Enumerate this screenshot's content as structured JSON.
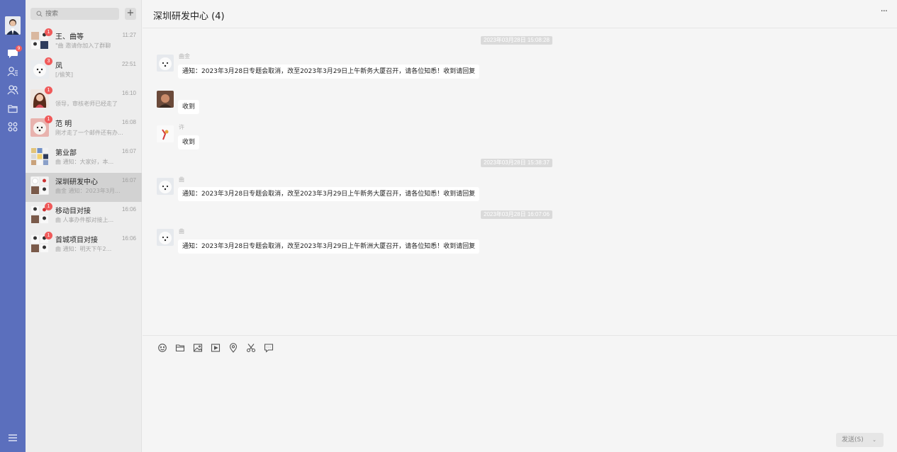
{
  "search": {
    "placeholder": "搜索"
  },
  "add_label": "+",
  "rail": {
    "unread_badge": "9"
  },
  "conversations": [
    {
      "name": "王、曲等",
      "time": "11:27",
      "preview": "\"曲 邀请你加入了群聊",
      "badge": "1"
    },
    {
      "name": "凤",
      "time": "22:51",
      "preview": "[/偷笑]",
      "badge": "3"
    },
    {
      "name": "",
      "time": "16:10",
      "preview": "领导，审核老师已经走了",
      "badge": "1"
    },
    {
      "name": "范 明",
      "time": "16:08",
      "preview": "刚才走了一个邮件还有办...",
      "badge": "1"
    },
    {
      "name": "第业部",
      "time": "16:07",
      "preview": "曲 通知：大家好，本...",
      "badge": ""
    },
    {
      "name": "深圳研发中心",
      "time": "16:07",
      "preview": "曲金 通知：2023年3月...",
      "badge": ""
    },
    {
      "name": "移动目对接",
      "time": "16:06",
      "preview": "曲 人事办件都对接上...",
      "badge": "1"
    },
    {
      "name": "首城项目对接",
      "time": "16:06",
      "preview": "曲 通知：明天下午2...",
      "badge": "1"
    }
  ],
  "chat": {
    "title": "深圳研发中心 (4)",
    "more": "···",
    "timestamps": [
      "2023年03月28日 15:08:28",
      "2023年03月28日 15:38:37",
      "2023年03月28日 16:07:06"
    ],
    "messages": [
      {
        "sender": "曲金",
        "text": "通知：2023年3月28日专题会取消，改至2023年3月29日上午新务大厦召开，请各位知悉！收到请回复"
      },
      {
        "sender": "",
        "text": "收到"
      },
      {
        "sender": "许",
        "text": "收到"
      },
      {
        "sender": "曲",
        "text": "通知：2023年3月28日专题会取消，改至2023年3月29日上午新务大厦召开，请各位知悉！收到请回复"
      },
      {
        "sender": "曲",
        "text": "通知：2023年3月28日专题会取消，改至2023年3月29日上午新洲大厦召开，请各位知悉！收到请回复"
      }
    ]
  },
  "send": {
    "label": "发送(S)",
    "caret": "⌄"
  },
  "colors": {
    "rail": "#5b6fbd",
    "badge": "#f05a5a",
    "list_bg": "#ededed",
    "active_row": "#d2d2d2"
  },
  "icons": [
    "chat-icon",
    "contacts-icon",
    "group-icon",
    "folder-icon",
    "apps-icon",
    "menu-icon",
    "emoji-icon",
    "file-icon",
    "image-icon",
    "video-icon",
    "location-icon",
    "scissors-icon",
    "comment-icon"
  ]
}
